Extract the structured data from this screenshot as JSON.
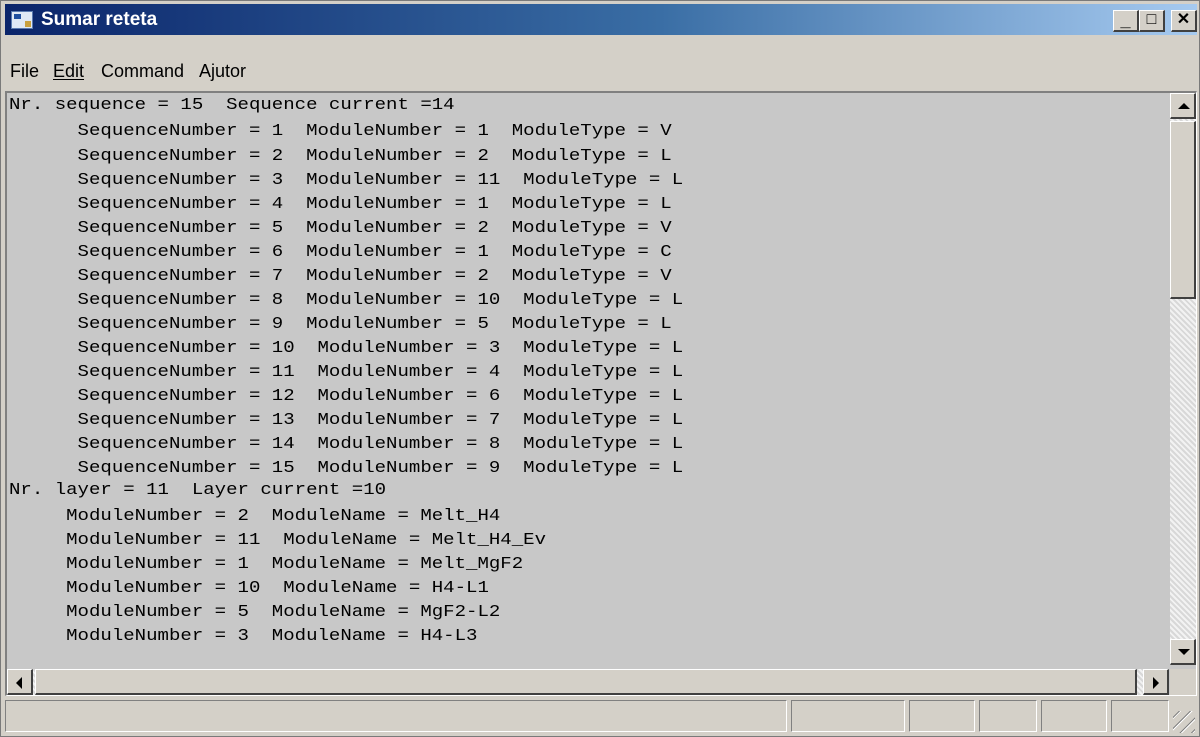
{
  "window": {
    "title": "Sumar reteta"
  },
  "title_buttons": {
    "minimize": "_",
    "maximize": "□",
    "close": "✕"
  },
  "menu": {
    "items": [
      "File",
      "Edit",
      "Command",
      "Ajutor"
    ]
  },
  "content": {
    "lines": [
      "Nr. sequence = 15  Sequence current =14",
      "      SequenceNumber = 1  ModuleNumber = 1  ModuleType = V",
      "      SequenceNumber = 2  ModuleNumber = 2  ModuleType = L",
      "      SequenceNumber = 3  ModuleNumber = 11  ModuleType = L",
      "      SequenceNumber = 4  ModuleNumber = 1  ModuleType = L",
      "      SequenceNumber = 5  ModuleNumber = 2  ModuleType = V",
      "      SequenceNumber = 6  ModuleNumber = 1  ModuleType = C",
      "      SequenceNumber = 7  ModuleNumber = 2  ModuleType = V",
      "      SequenceNumber = 8  ModuleNumber = 10  ModuleType = L",
      "      SequenceNumber = 9  ModuleNumber = 5  ModuleType = L",
      "      SequenceNumber = 10  ModuleNumber = 3  ModuleType = L",
      "      SequenceNumber = 11  ModuleNumber = 4  ModuleType = L",
      "      SequenceNumber = 12  ModuleNumber = 6  ModuleType = L",
      "      SequenceNumber = 13  ModuleNumber = 7  ModuleType = L",
      "      SequenceNumber = 14  ModuleNumber = 8  ModuleType = L",
      "      SequenceNumber = 15  ModuleNumber = 9  ModuleType = L",
      "Nr. layer = 11  Layer current =10",
      "     ModuleNumber = 2  ModuleName = Melt_H4",
      "     ModuleNumber = 11  ModuleName = Melt_H4_Ev",
      "     ModuleNumber = 1  ModuleName = Melt_MgF2",
      "     ModuleNumber = 10  ModuleName = H4-L1",
      "     ModuleNumber = 5  ModuleName = MgF2-L2",
      "     ModuleNumber = 3  ModuleName = H4-L3"
    ]
  },
  "colors": {
    "titlebar_start": "#0a246a",
    "titlebar_end": "#a6caf0",
    "chrome": "#d4d0c8",
    "text_area_bg": "#c8c8c8"
  }
}
